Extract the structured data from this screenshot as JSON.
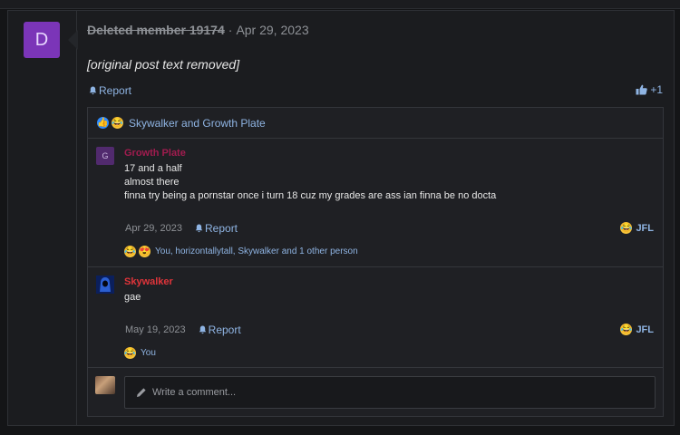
{
  "colors": {
    "accent_link": "#8fb4e3",
    "deleted_avatar_bg": "#7b35b8",
    "growth_plate_avatar_bg": "#512a6e",
    "growth_plate_name": "#a11c4f",
    "skywalker_name": "#e0343a",
    "skywalker_avatar_bg": "#0b1f5c"
  },
  "post": {
    "avatar_letter": "D",
    "author": "Deleted member 19174",
    "separator": "·",
    "date": "Apr 29, 2023",
    "body": "[original post text removed]",
    "report_label": "Report",
    "like_count": "+1"
  },
  "reaction_summary": {
    "icons": [
      "like-icon",
      "laugh-icon"
    ],
    "text": "Skywalker and Growth Plate"
  },
  "replies": [
    {
      "avatar_letter": "G",
      "author": "Growth Plate",
      "lines": [
        "17 and a half",
        "almost there",
        "finna try being a pornstar once i turn 18 cuz my grades are ass ian finna be no docta"
      ],
      "date": "Apr 29, 2023",
      "report_label": "Report",
      "reaction_button": "JFL",
      "reactions_icons": [
        "laugh-icon",
        "love-icon"
      ],
      "reactions_text": "You, horizontallytall, Skywalker and 1 other person"
    },
    {
      "avatar_letter": "",
      "author": "Skywalker",
      "lines": [
        "gae"
      ],
      "date": "May 19, 2023",
      "report_label": "Report",
      "reaction_button": "JFL",
      "reactions_icons": [
        "laugh-icon"
      ],
      "reactions_text": "You"
    }
  ],
  "comment_box": {
    "placeholder": "Write a comment..."
  }
}
